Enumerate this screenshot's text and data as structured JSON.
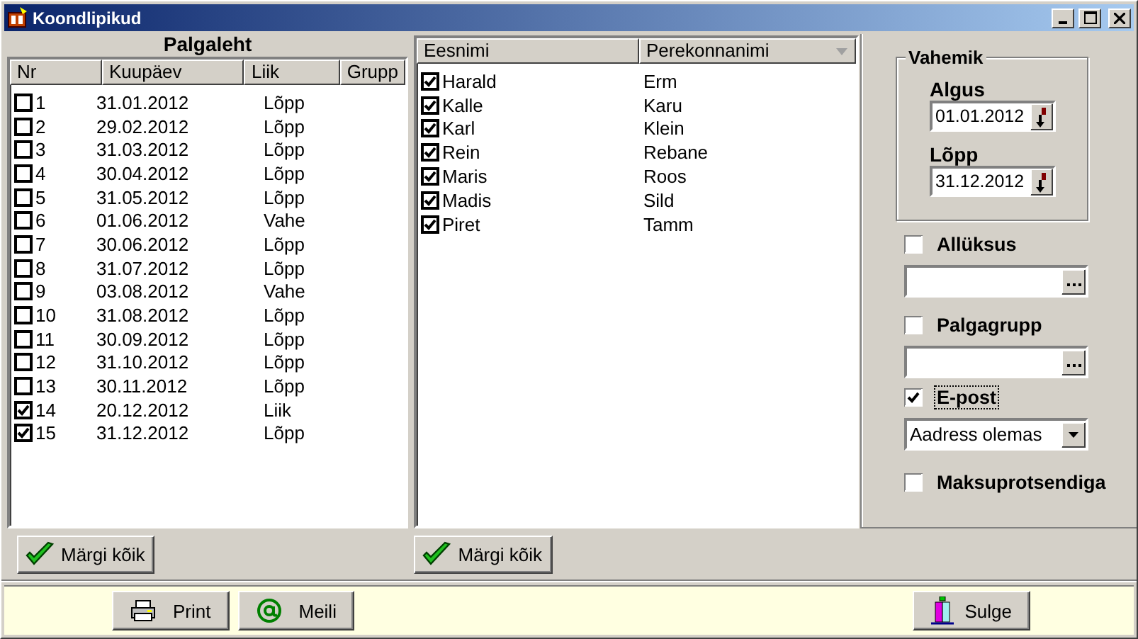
{
  "window": {
    "title": "Koondlipikud"
  },
  "payroll": {
    "title": "Palgaleht",
    "columns": [
      "Nr",
      "Kuupäev",
      "Liik",
      "Grupp"
    ],
    "rows": [
      {
        "checked": false,
        "cells": [
          "1",
          "31.01.2012",
          "Lõpp"
        ]
      },
      {
        "checked": false,
        "cells": [
          "2",
          "29.02.2012",
          "Lõpp"
        ]
      },
      {
        "checked": false,
        "cells": [
          "3",
          "31.03.2012",
          "Lõpp"
        ]
      },
      {
        "checked": false,
        "cells": [
          "4",
          "30.04.2012",
          "Lõpp"
        ]
      },
      {
        "checked": false,
        "cells": [
          "5",
          "31.05.2012",
          "Lõpp"
        ]
      },
      {
        "checked": false,
        "cells": [
          "6",
          "01.06.2012",
          "Vahe"
        ]
      },
      {
        "checked": false,
        "cells": [
          "7",
          "30.06.2012",
          "Lõpp"
        ]
      },
      {
        "checked": false,
        "cells": [
          "8",
          "31.07.2012",
          "Lõpp"
        ]
      },
      {
        "checked": false,
        "cells": [
          "9",
          "03.08.2012",
          "Vahe"
        ]
      },
      {
        "checked": false,
        "cells": [
          "10",
          "31.08.2012",
          "Lõpp"
        ]
      },
      {
        "checked": false,
        "cells": [
          "11",
          "30.09.2012",
          "Lõpp"
        ]
      },
      {
        "checked": false,
        "cells": [
          "12",
          "31.10.2012",
          "Lõpp"
        ]
      },
      {
        "checked": false,
        "cells": [
          "13",
          "30.11.2012",
          "Lõpp"
        ]
      },
      {
        "checked": true,
        "cells": [
          "14",
          "20.12.2012",
          "Liik"
        ]
      },
      {
        "checked": true,
        "cells": [
          "15",
          "31.12.2012",
          "Lõpp"
        ]
      }
    ],
    "button": "Märgi kõik"
  },
  "employees": {
    "columns": [
      "Eesnimi",
      "Perekonnanimi"
    ],
    "rows": [
      {
        "checked": true,
        "cells": [
          "Harald",
          "Erm"
        ]
      },
      {
        "checked": true,
        "cells": [
          "Kalle",
          "Karu"
        ]
      },
      {
        "checked": true,
        "cells": [
          "Karl",
          "Klein"
        ]
      },
      {
        "checked": true,
        "cells": [
          "Rein",
          "Rebane"
        ]
      },
      {
        "checked": true,
        "cells": [
          "Maris",
          "Roos"
        ]
      },
      {
        "checked": true,
        "cells": [
          "Madis",
          "Sild"
        ]
      },
      {
        "checked": true,
        "cells": [
          "Piret",
          "Tamm"
        ]
      }
    ],
    "button": "Märgi kõik"
  },
  "filters": {
    "period": {
      "title": "Vahemik",
      "start": {
        "label": "Algus",
        "value": "01.01.2012"
      },
      "end": {
        "label": "Lõpp",
        "value": "31.12.2012"
      }
    },
    "options": [
      {
        "kind": "lookup",
        "label": "Allüksus",
        "checked": false,
        "focused": false
      },
      {
        "kind": "lookup",
        "label": "Palgagrupp",
        "checked": false,
        "focused": false
      },
      {
        "kind": "select",
        "label": "E-post",
        "checked": true,
        "focused": true,
        "value": "Aadress olemas"
      },
      {
        "kind": "checkbox",
        "label": "Maksuprotsendiga",
        "checked": false,
        "focused": false
      }
    ]
  },
  "footer": {
    "buttons": [
      {
        "kind": "print",
        "label": "Print"
      },
      {
        "kind": "mail",
        "label": "Meili"
      },
      {
        "kind": "exit",
        "label": "Sulge"
      }
    ]
  }
}
